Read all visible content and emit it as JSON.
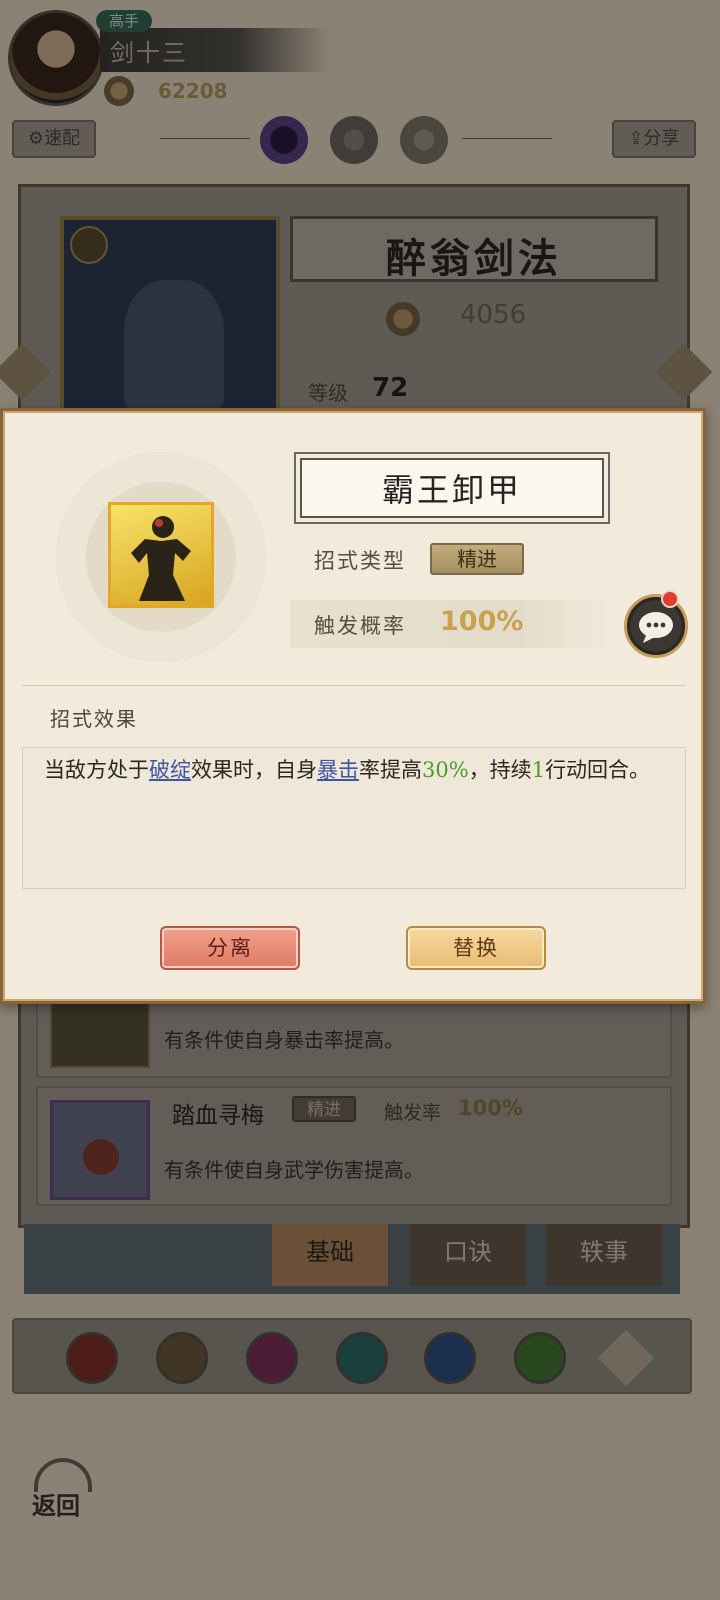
{
  "player": {
    "rank_badge": "高手",
    "name": "剑十三",
    "power": "62208"
  },
  "top_bar": {
    "quick_equip_label": "速配",
    "share_label": "分享"
  },
  "martial_art": {
    "title": "醉翁剑法",
    "power": "4056",
    "level_label": "等级",
    "level_value": "72"
  },
  "moves_list": [
    {
      "desc": "有条件使自身暴击率提高。"
    },
    {
      "name": "踏血寻梅",
      "type": "精进",
      "rate_label": "触发率",
      "rate": "100%",
      "desc": "有条件使自身武学伤害提高。"
    }
  ],
  "tabs": [
    {
      "label": "基础"
    },
    {
      "label": "口诀"
    },
    {
      "label": "轶事"
    }
  ],
  "dialog": {
    "skill_name": "霸王卸甲",
    "type_label": "招式类型",
    "type_value": "精进",
    "rate_label": "触发概率",
    "rate_value": "100%",
    "effect_label": "招式效果",
    "effect": {
      "p1": "当敌方处于",
      "kw1": "破绽",
      "p2": "效果时，自身",
      "kw2": "暴击",
      "p3": "率提高",
      "n1": "30%",
      "p4": "，持续",
      "n2": "1",
      "p5": "行动回合。"
    },
    "split_label": "分离",
    "replace_label": "替换"
  },
  "back_label": "返回",
  "sect_icons": [
    "sword-sect-icon",
    "blade-sect-icon",
    "fist-sect-icon",
    "fan-sect-icon",
    "taiji-sect-icon",
    "leaf-sect-icon",
    "more-sect-icon"
  ],
  "colors": {
    "dialog_bg": "#f2ebdc",
    "keyword_blue": "#3d55a8",
    "number_green": "#4b9a2c",
    "rate_gold": "#c8a24c",
    "split_btn": "#df7a66",
    "replace_btn": "#e7bc72"
  }
}
